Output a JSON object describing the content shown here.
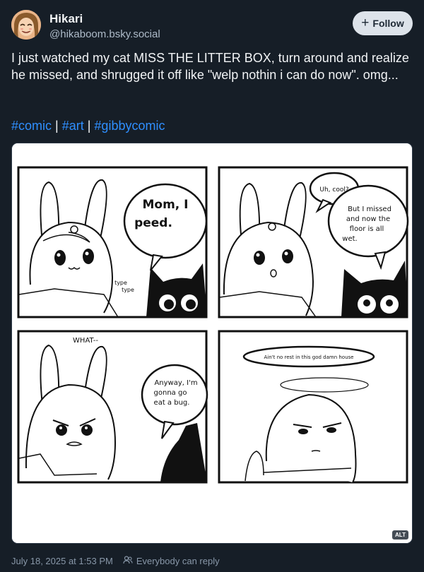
{
  "author": {
    "name": "Hikari",
    "handle": "@hikaboom.bsky.social"
  },
  "follow_button": {
    "label": "Follow"
  },
  "post": {
    "text": "I just watched my cat MISS THE LITTER BOX, turn around and realize he missed, and shrugged it off like \"welp nothin i can do now\". omg...",
    "tags": [
      "#comic",
      "#art",
      "#gibbycomic"
    ]
  },
  "comic": {
    "panel1_speech": [
      "Mom, I",
      "peed."
    ],
    "panel1_sfx": [
      "type",
      "type"
    ],
    "panel2_speech_small": "Uh, cool?",
    "panel2_speech": [
      "But I missed",
      "and now the",
      "floor is all",
      "wet."
    ],
    "panel3_sfx": "WHAT--",
    "panel3_speech": [
      "Anyway, I'm",
      "gonna go",
      "eat a bug."
    ],
    "panel4_speech": "Ain't no rest in this god damn house",
    "alt_badge": "ALT"
  },
  "footer": {
    "timestamp": "July 18, 2025 at 1:53 PM",
    "reply_setting": "Everybody can reply"
  },
  "colors": {
    "background": "#161e27",
    "tag_link": "#2f8fff",
    "follow_bg": "#dde3ea"
  }
}
